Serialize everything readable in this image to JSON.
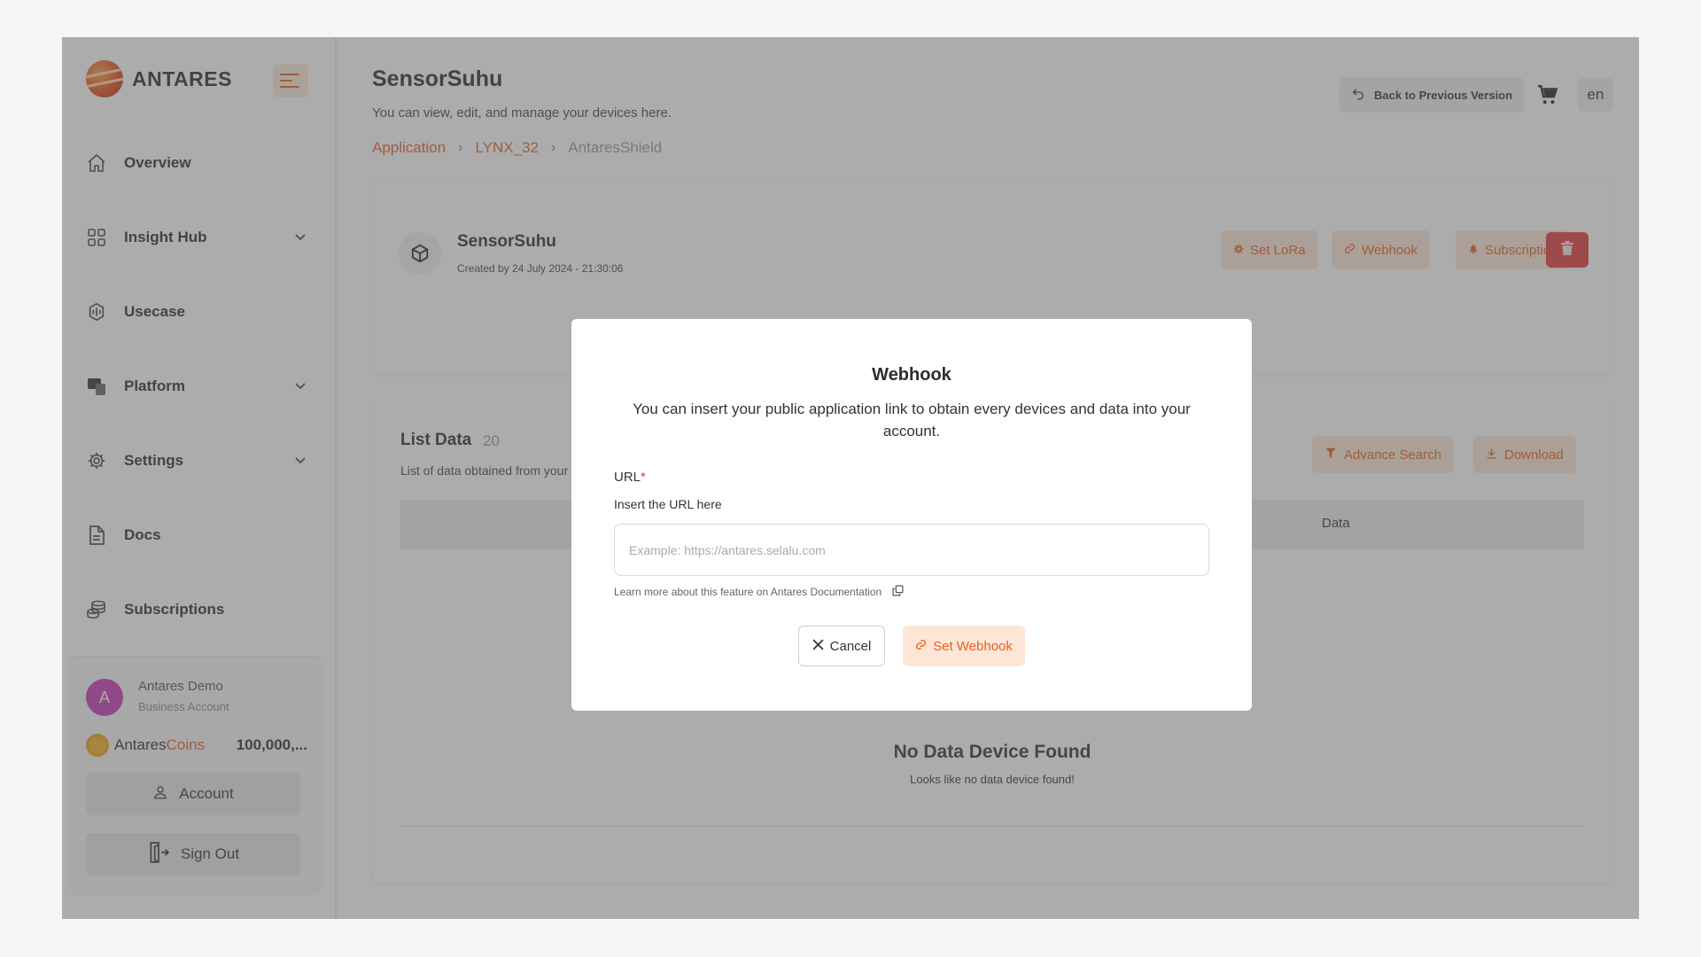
{
  "brand": {
    "name": "ANTARES"
  },
  "sidebar": {
    "items": [
      {
        "label": "Overview",
        "icon": "home-icon"
      },
      {
        "label": "Insight Hub",
        "icon": "grid-icon",
        "expandable": true
      },
      {
        "label": "Usecase",
        "icon": "usecase-icon"
      },
      {
        "label": "Platform",
        "icon": "platform-icon",
        "expandable": true
      },
      {
        "label": "Settings",
        "icon": "gear-icon",
        "expandable": true
      },
      {
        "label": "Docs",
        "icon": "document-icon"
      },
      {
        "label": "Subscriptions",
        "icon": "coins-stack-icon"
      }
    ],
    "user": {
      "initial": "A",
      "name": "Antares Demo",
      "account_type": "Business Account",
      "coins_label_a": "Antares",
      "coins_label_b": "Coins",
      "coins_value": "100,000,..."
    },
    "account_button": "Account",
    "signout_button": "Sign Out"
  },
  "header": {
    "title": "SensorSuhu",
    "subtitle": "You can view, edit, and manage your devices here.",
    "breadcrumb": [
      "Application",
      "LYNX_32",
      "AntaresShield"
    ],
    "back_button": "Back to Previous Version",
    "language": "en"
  },
  "device": {
    "name": "SensorSuhu",
    "created": "Created by 24 July 2024 - 21:30:06",
    "actions": {
      "set_lora": "Set LoRa",
      "webhook": "Webhook",
      "subscription": "Subscription"
    }
  },
  "list": {
    "title": "List Data",
    "count": "20",
    "description": "List of data obtained from your device",
    "advance_search": "Advance Search",
    "download": "Download",
    "column_data": "Data",
    "empty_title": "No Data Device Found",
    "empty_sub": "Looks like no data device found!"
  },
  "modal": {
    "title": "Webhook",
    "description": "You can insert your public application link to obtain every devices and data into your account.",
    "url_label": "URL",
    "required_mark": "*",
    "url_help": "Insert the URL here",
    "url_value": "",
    "url_placeholder": "Example: https://antares.selalu.com",
    "doc_link": "Learn more about this feature on Antares Documentation",
    "cancel": "Cancel",
    "submit": "Set Webhook"
  },
  "colors": {
    "accent": "#e4601f",
    "accent_light": "#fde6d6",
    "danger": "#e03b3b"
  }
}
